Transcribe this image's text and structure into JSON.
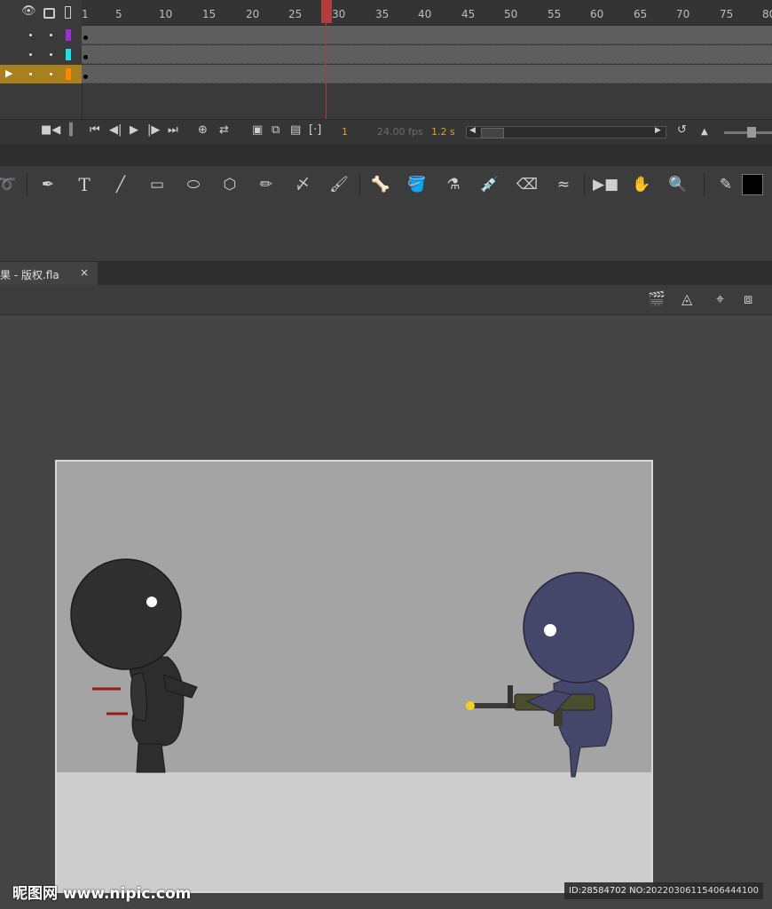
{
  "timeline": {
    "ruler_labels": [
      "1",
      "5",
      "10",
      "15",
      "20",
      "25",
      "30",
      "35",
      "40",
      "45",
      "50",
      "55",
      "60",
      "65",
      "70",
      "75",
      "80"
    ],
    "current_frame": "1",
    "fps": "24.00 fps",
    "time": "1.2 s",
    "layer_colors": [
      "#9b2fd6",
      "#1fe0e8",
      "#ff8800"
    ]
  },
  "tools": [
    "lasso-icon",
    "pen-icon",
    "text-icon",
    "line-icon",
    "rectangle-icon",
    "oval-icon",
    "polystar-icon",
    "pencil-icon",
    "paint-brush-icon",
    "brush-icon",
    "bone-icon",
    "paint-bucket-icon",
    "ink-bottle-icon",
    "eyedropper-icon",
    "eraser-icon",
    "width-tool-icon",
    "camera-icon",
    "hand-icon",
    "zoom-icon",
    "stroke-color-icon"
  ],
  "document": {
    "tab_label": "效果 - 版权.fla",
    "close": "×"
  },
  "stage": {
    "background_top": "#a4a4a4",
    "floor_color": "#cdcdcd",
    "dark_character_color": "#2d2d2d",
    "blue_character_color": "#45476a"
  },
  "watermark": {
    "logo": "昵图网 www.nipic.com",
    "id": "ID:28584702 NO:20220306115406444100"
  }
}
